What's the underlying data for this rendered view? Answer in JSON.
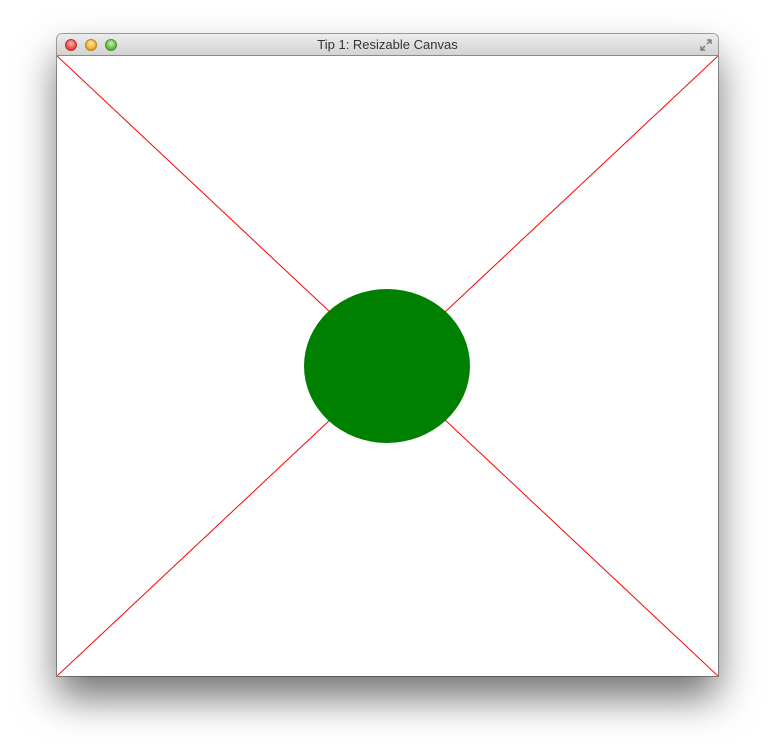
{
  "window": {
    "title": "Tip 1: Resizable Canvas",
    "buttons": {
      "close": "close-button",
      "minimize": "minimize-button",
      "zoom": "zoom-button",
      "fullscreen": "fullscreen-icon"
    }
  },
  "canvas": {
    "background_color": "#ffffff",
    "line_color": "#ff0000",
    "circle_color": "#008000"
  }
}
